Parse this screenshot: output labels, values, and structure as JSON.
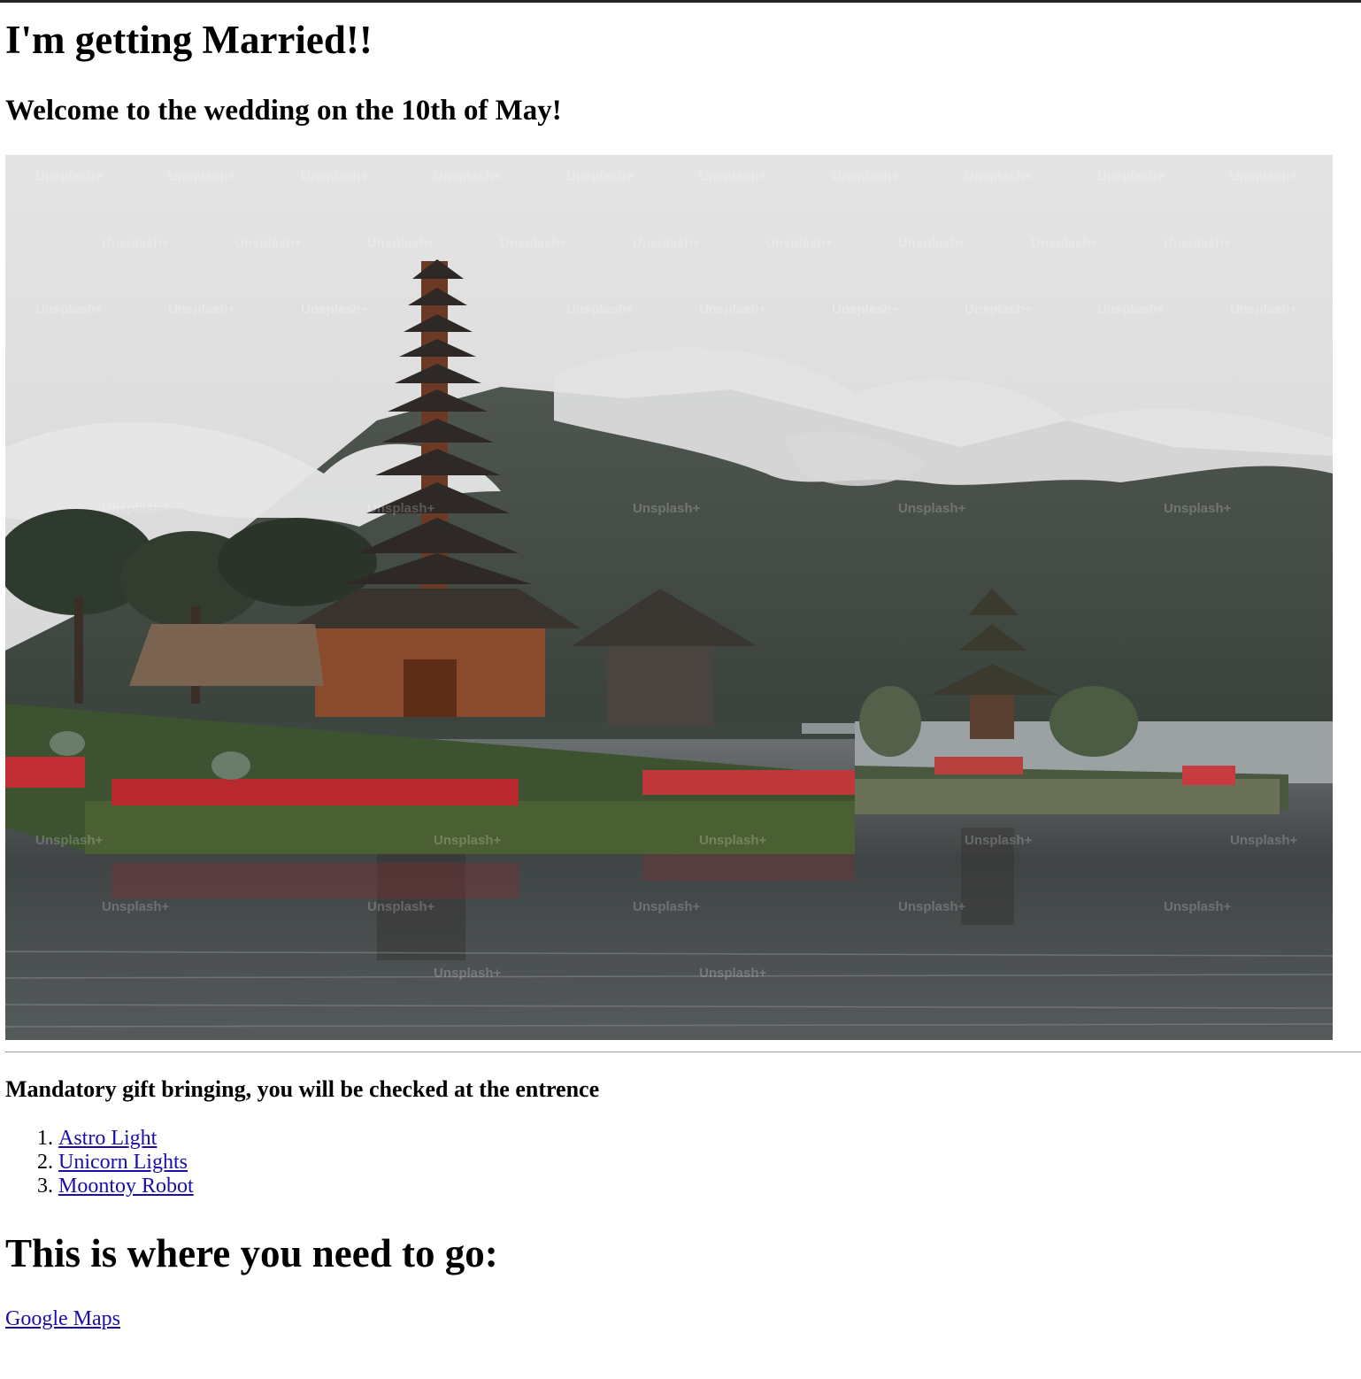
{
  "header": {
    "title": "I'm getting Married!!",
    "subtitle": "Welcome to the wedding on the 10th of May!"
  },
  "hero_image": {
    "watermark_text": "Unsplash+",
    "icon": "temple-lake-photo"
  },
  "gifts": {
    "heading": "Mandatory gift bringing, you will be checked at the entrence",
    "items": [
      {
        "label": "Astro Light"
      },
      {
        "label": "Unicorn Lights"
      },
      {
        "label": "Moontoy Robot"
      }
    ]
  },
  "location": {
    "heading": "This is where you need to go:",
    "link_label": "Google Maps"
  },
  "colors": {
    "link": "#1a0dab",
    "top_border": "#222222"
  }
}
